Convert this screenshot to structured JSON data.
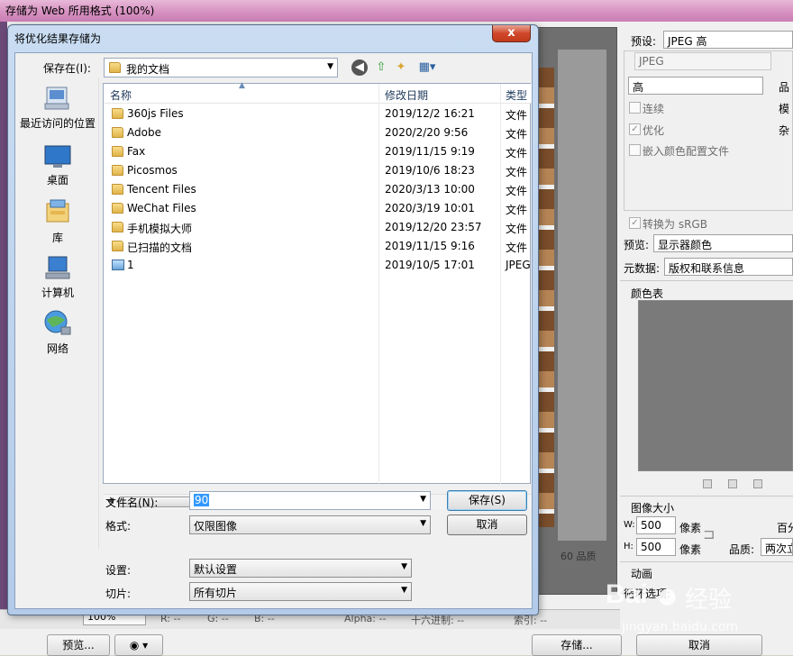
{
  "bg_window": {
    "title": "存储为 Web 所用格式 (100%)",
    "quality_status": "60 品质"
  },
  "right_panel": {
    "preset_label": "预设:",
    "preset_value": "JPEG 高",
    "format_value": "JPEG",
    "quality_value": "高",
    "quality_label_partial": "品",
    "progressive_label": "连续",
    "optimized_label": "优化",
    "embed_profile_label": "嵌入颜色配置文件",
    "blur_partial": "模",
    "matte_partial": "杂",
    "convert_srgb_label": "转换为 sRGB",
    "preview_label": "预览:",
    "preview_value": "显示器颜色",
    "metadata_label": "元数据:",
    "metadata_value": "版权和联系信息",
    "color_table_label": "颜色表",
    "image_size_label": "图像大小",
    "width_label": "W:",
    "width_value": "500",
    "height_label": "H:",
    "height_value": "500",
    "pixels_label": "像素",
    "percent_partial": "百分",
    "quality2_label": "品质:",
    "quality2_value": "两次立",
    "animation_label": "动画",
    "loop_label": "循环选项:"
  },
  "bottom_bar": {
    "zoom": "100%",
    "r": "R: --",
    "g": "G: --",
    "b": "B: --",
    "alpha": "Alpha: --",
    "hex": "十六进制: --",
    "index": "索引: --",
    "preview_button": "预览...",
    "save_button": "存储...",
    "cancel_button": "取消"
  },
  "dialog": {
    "title": "将优化结果存储为",
    "close_symbol": "x",
    "look_in_label": "保存在(I):",
    "look_in_value": "我的文档",
    "places": [
      {
        "label": "最近访问的位置",
        "icon": "recent-places-icon"
      },
      {
        "label": "桌面",
        "icon": "desktop-icon"
      },
      {
        "label": "库",
        "icon": "libraries-icon"
      },
      {
        "label": "计算机",
        "icon": "computer-icon"
      },
      {
        "label": "网络",
        "icon": "network-icon"
      }
    ],
    "columns": {
      "name": "名称",
      "date": "修改日期",
      "type": "类型"
    },
    "files": [
      {
        "name": "360js Files",
        "date": "2019/12/2 16:21",
        "type": "文件",
        "icon": "folder"
      },
      {
        "name": "Adobe",
        "date": "2020/2/20 9:56",
        "type": "文件",
        "icon": "folder"
      },
      {
        "name": "Fax",
        "date": "2019/11/15 9:19",
        "type": "文件",
        "icon": "folder"
      },
      {
        "name": "Picosmos",
        "date": "2019/10/6 18:23",
        "type": "文件",
        "icon": "folder"
      },
      {
        "name": "Tencent Files",
        "date": "2020/3/13 10:00",
        "type": "文件",
        "icon": "folder"
      },
      {
        "name": "WeChat Files",
        "date": "2020/3/19 10:01",
        "type": "文件",
        "icon": "folder"
      },
      {
        "name": "手机模拟大师",
        "date": "2019/12/20 23:57",
        "type": "文件",
        "icon": "folder"
      },
      {
        "name": "已扫描的文档",
        "date": "2019/11/15 9:16",
        "type": "文件",
        "icon": "folder"
      },
      {
        "name": "1",
        "date": "2019/10/5 17:01",
        "type": "JPEG",
        "icon": "image"
      }
    ],
    "scroll_grip": "III",
    "filename_label": "文件名(N):",
    "filename_value": "90",
    "format_label": "格式:",
    "format_value": "仅限图像",
    "save_button": "保存(S)",
    "cancel_button": "取消",
    "settings_label": "设置:",
    "settings_value": "默认设置",
    "slices_label": "切片:",
    "slices_value": "所有切片"
  },
  "watermark": {
    "brand": "Bai",
    "brand2": "经验",
    "url": "jingyan.baidu.com"
  }
}
